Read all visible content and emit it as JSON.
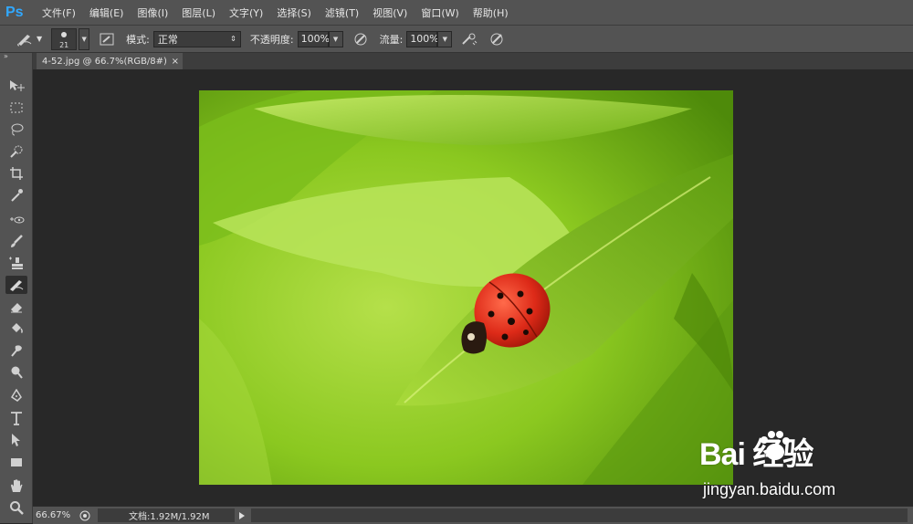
{
  "app": {
    "logo": "Ps"
  },
  "menu": [
    "文件(F)",
    "编辑(E)",
    "图像(I)",
    "图层(L)",
    "文字(Y)",
    "选择(S)",
    "滤镜(T)",
    "视图(V)",
    "窗口(W)",
    "帮助(H)"
  ],
  "options": {
    "brush_size": "21",
    "mode_label": "模式:",
    "mode_value": "正常",
    "opacity_label": "不透明度:",
    "opacity_value": "100%",
    "flow_label": "流量:",
    "flow_value": "100%"
  },
  "document": {
    "tab_title": "4-52.jpg @ 66.7%(RGB/8#)",
    "close_glyph": "×"
  },
  "status": {
    "zoom": "66.67%",
    "doc_info": "文档:1.92M/1.92M"
  },
  "watermark": {
    "brand": "Bai 经验",
    "url": "jingyan.baidu.com"
  },
  "colors": {
    "ui_panel": "#535353",
    "canvas_bg": "#282828",
    "logo": "#31a8ff",
    "leaf_green": "#8fcc20",
    "ladybug_red": "#d8281a"
  }
}
